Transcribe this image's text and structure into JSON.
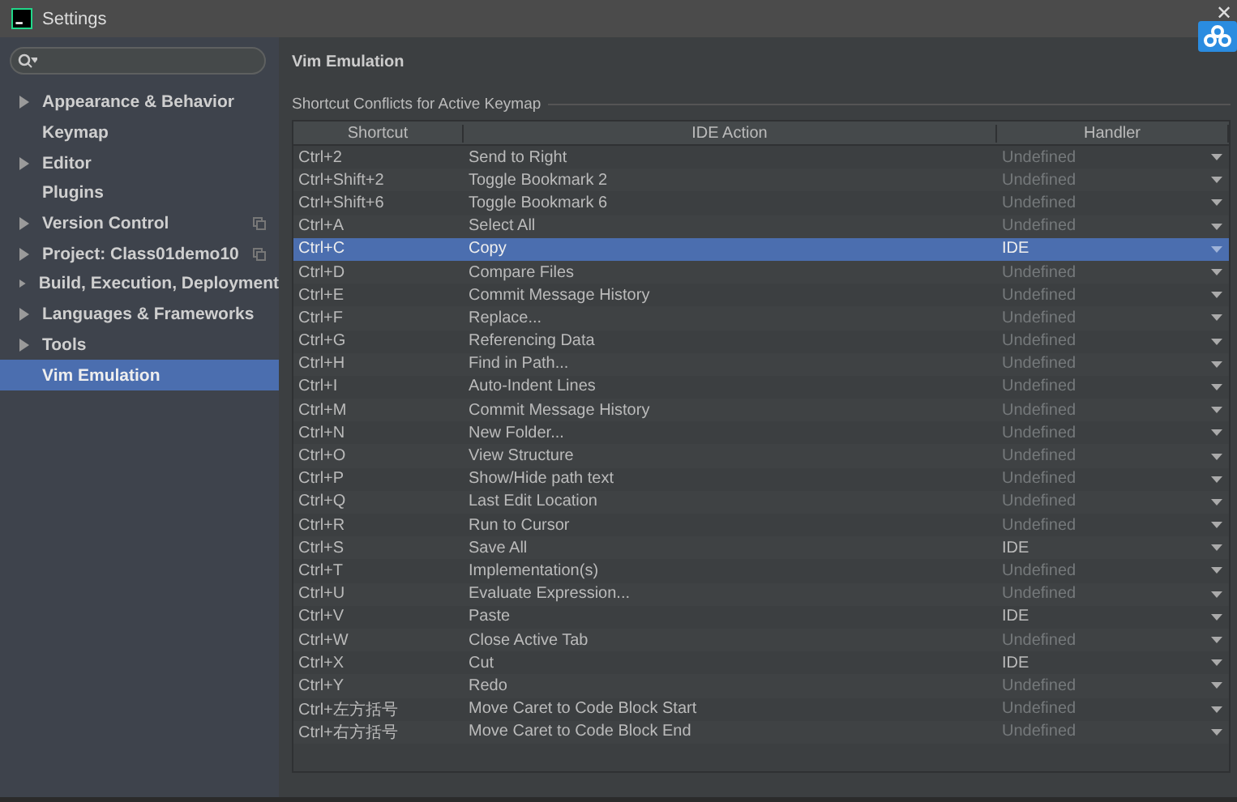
{
  "window": {
    "title": "Settings",
    "close": "✕"
  },
  "sidebar": {
    "items": [
      {
        "label": "Appearance & Behavior",
        "expandable": true,
        "selected": false,
        "project_level": false
      },
      {
        "label": "Keymap",
        "expandable": false,
        "selected": false,
        "project_level": false
      },
      {
        "label": "Editor",
        "expandable": true,
        "selected": false,
        "project_level": false
      },
      {
        "label": "Plugins",
        "expandable": false,
        "selected": false,
        "project_level": false
      },
      {
        "label": "Version Control",
        "expandable": true,
        "selected": false,
        "project_level": true
      },
      {
        "label": "Project: Class01demo10",
        "expandable": true,
        "selected": false,
        "project_level": true
      },
      {
        "label": "Build, Execution, Deployment",
        "expandable": true,
        "selected": false,
        "project_level": false
      },
      {
        "label": "Languages & Frameworks",
        "expandable": true,
        "selected": false,
        "project_level": false
      },
      {
        "label": "Tools",
        "expandable": true,
        "selected": false,
        "project_level": false
      },
      {
        "label": "Vim Emulation",
        "expandable": false,
        "selected": true,
        "project_level": false
      }
    ]
  },
  "page": {
    "title": "Vim Emulation",
    "section": "Shortcut Conflicts for Active Keymap"
  },
  "table": {
    "columns": [
      "Shortcut",
      "IDE Action",
      "Handler"
    ],
    "rows": [
      {
        "shortcut": "Ctrl+2",
        "action": "Send to Right",
        "handler": "Undefined",
        "defined": false,
        "selected": false
      },
      {
        "shortcut": "Ctrl+Shift+2",
        "action": "Toggle Bookmark 2",
        "handler": "Undefined",
        "defined": false,
        "selected": false
      },
      {
        "shortcut": "Ctrl+Shift+6",
        "action": "Toggle Bookmark 6",
        "handler": "Undefined",
        "defined": false,
        "selected": false
      },
      {
        "shortcut": "Ctrl+A",
        "action": "Select All",
        "handler": "Undefined",
        "defined": false,
        "selected": false
      },
      {
        "shortcut": "Ctrl+C",
        "action": "Copy",
        "handler": "IDE",
        "defined": true,
        "selected": true
      },
      {
        "shortcut": "Ctrl+D",
        "action": "Compare Files",
        "handler": "Undefined",
        "defined": false,
        "selected": false
      },
      {
        "shortcut": "Ctrl+E",
        "action": "Commit Message History",
        "handler": "Undefined",
        "defined": false,
        "selected": false
      },
      {
        "shortcut": "Ctrl+F",
        "action": "Replace...",
        "handler": "Undefined",
        "defined": false,
        "selected": false
      },
      {
        "shortcut": "Ctrl+G",
        "action": "Referencing Data",
        "handler": "Undefined",
        "defined": false,
        "selected": false
      },
      {
        "shortcut": "Ctrl+H",
        "action": "Find in Path...",
        "handler": "Undefined",
        "defined": false,
        "selected": false
      },
      {
        "shortcut": "Ctrl+I",
        "action": "Auto-Indent Lines",
        "handler": "Undefined",
        "defined": false,
        "selected": false
      },
      {
        "shortcut": "Ctrl+M",
        "action": "Commit Message History",
        "handler": "Undefined",
        "defined": false,
        "selected": false
      },
      {
        "shortcut": "Ctrl+N",
        "action": "New Folder...",
        "handler": "Undefined",
        "defined": false,
        "selected": false
      },
      {
        "shortcut": "Ctrl+O",
        "action": "View Structure",
        "handler": "Undefined",
        "defined": false,
        "selected": false
      },
      {
        "shortcut": "Ctrl+P",
        "action": "Show/Hide path text",
        "handler": "Undefined",
        "defined": false,
        "selected": false
      },
      {
        "shortcut": "Ctrl+Q",
        "action": "Last Edit Location",
        "handler": "Undefined",
        "defined": false,
        "selected": false
      },
      {
        "shortcut": "Ctrl+R",
        "action": "Run to Cursor",
        "handler": "Undefined",
        "defined": false,
        "selected": false
      },
      {
        "shortcut": "Ctrl+S",
        "action": "Save All",
        "handler": "IDE",
        "defined": true,
        "selected": false
      },
      {
        "shortcut": "Ctrl+T",
        "action": "Implementation(s)",
        "handler": "Undefined",
        "defined": false,
        "selected": false
      },
      {
        "shortcut": "Ctrl+U",
        "action": "Evaluate Expression...",
        "handler": "Undefined",
        "defined": false,
        "selected": false
      },
      {
        "shortcut": "Ctrl+V",
        "action": "Paste",
        "handler": "IDE",
        "defined": true,
        "selected": false
      },
      {
        "shortcut": "Ctrl+W",
        "action": "Close Active Tab",
        "handler": "Undefined",
        "defined": false,
        "selected": false
      },
      {
        "shortcut": "Ctrl+X",
        "action": "Cut",
        "handler": "IDE",
        "defined": true,
        "selected": false
      },
      {
        "shortcut": "Ctrl+Y",
        "action": "Redo",
        "handler": "Undefined",
        "defined": false,
        "selected": false
      },
      {
        "shortcut": "Ctrl+左方括号",
        "action": "Move Caret to Code Block Start",
        "handler": "Undefined",
        "defined": false,
        "selected": false
      },
      {
        "shortcut": "Ctrl+右方括号",
        "action": "Move Caret to Code Block End",
        "handler": "Undefined",
        "defined": false,
        "selected": false
      }
    ]
  }
}
